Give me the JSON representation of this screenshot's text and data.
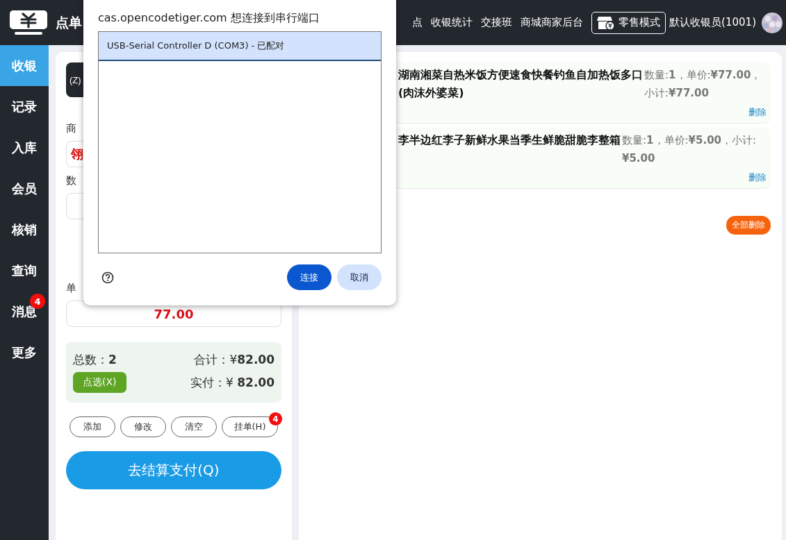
{
  "header": {
    "title": "点单",
    "nav": [
      {
        "label": "点"
      },
      {
        "label": "收银统计"
      },
      {
        "label": "交接班"
      },
      {
        "label": "商城商家后台"
      }
    ],
    "mode_button": "零售模式",
    "user": "默认收银员(1001)"
  },
  "sidebar": [
    {
      "label": "收银",
      "selected": true
    },
    {
      "label": "记录",
      "selected": false
    },
    {
      "label": "入库",
      "selected": false
    },
    {
      "label": "会员",
      "selected": false
    },
    {
      "label": "核销",
      "selected": false
    },
    {
      "label": "查询",
      "selected": false
    },
    {
      "label": "消息",
      "selected": false,
      "badge": "4"
    },
    {
      "label": "更多",
      "selected": false
    }
  ],
  "order_panel": {
    "scan_button": "(Z)",
    "product_label": "商",
    "product_value": "翎",
    "quantity_label": "数",
    "price_label": "单",
    "price_value": "77.00",
    "summary": {
      "count_label": "总数：",
      "count": "2",
      "total_label": "合计：",
      "total": "¥**82.00**",
      "paid_label": "实付：",
      "paid": "¥ **82.00**",
      "pick_button": "点选(X)"
    },
    "actions": [
      {
        "label": "添加"
      },
      {
        "label": "修改"
      },
      {
        "label": "清空"
      },
      {
        "label": "挂单(H)",
        "badge": "4"
      }
    ],
    "pay_button": "去结算支付(Q)"
  },
  "cart": {
    "items": [
      {
        "name": "湖南湘菜自热米饭方便速食快餐钓鱼自加热饭多口\n(肉沫外婆菜)",
        "detail": "数量:**1**，单价:**¥77.00**，小计:**¥77.00**",
        "delete": "删除"
      },
      {
        "name": "李半边红李子新鲜水果当季生鲜脆甜脆李整箱",
        "detail": "数量:**1**，单价:**¥5.00**，小计:**¥5.00**",
        "delete": "删除"
      }
    ],
    "clear_all": "全部删除"
  },
  "dialog": {
    "title": "cas.opencodetiger.com 想连接到串行端口",
    "ports": [
      {
        "label": "USB-Serial Controller D (COM3) - 已配对",
        "selected": true
      }
    ],
    "connect_button": "连接",
    "cancel_button": "取消"
  }
}
